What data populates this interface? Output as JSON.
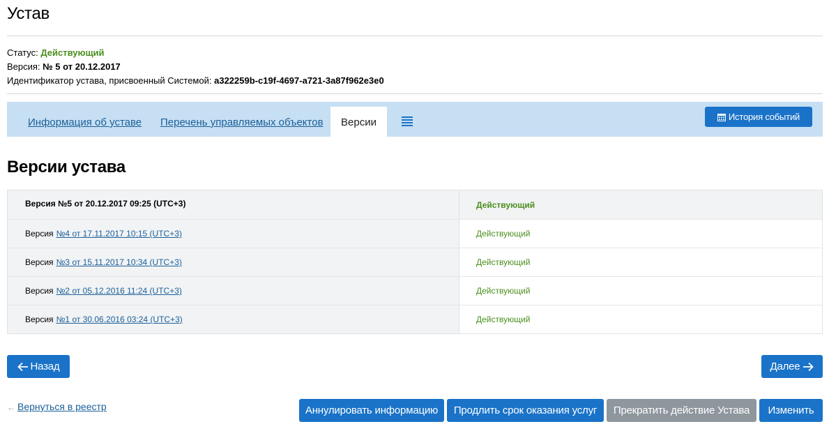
{
  "page": {
    "title": "Устав"
  },
  "meta": {
    "status_label": "Статус:",
    "status_value": "Действующий",
    "version_label": "Версия:",
    "version_value": "№ 5 от 20.12.2017",
    "id_label": "Идентификатор устава, присвоенный Системой:",
    "id_value": "a322259b-c19f-4697-a721-3a87f962e3e0"
  },
  "tabs": [
    {
      "label": "Информация об уставе"
    },
    {
      "label": "Перечень управляемых объектов"
    },
    {
      "label": "Версии"
    }
  ],
  "history_button": {
    "label": "История событий",
    "icon": "calendar-icon"
  },
  "section": {
    "title": "Версии устава"
  },
  "versions": [
    {
      "prefix": "Версия №5 от 20.12.2017 09:25 (UTC+3)",
      "link": "",
      "status": "Действующий"
    },
    {
      "prefix": "Версия",
      "link": "№4 от 17.11.2017 10:15 (UTC+3)",
      "status": "Действующий"
    },
    {
      "prefix": "Версия",
      "link": "№3 от 15.11.2017 10:34 (UTC+3)",
      "status": "Действующий"
    },
    {
      "prefix": "Версия",
      "link": "№2 от 05.12.2016 11:24 (UTC+3)",
      "status": "Действующий"
    },
    {
      "prefix": "Версия",
      "link": "№1 от 30.06.2016 03:24 (UTC+3)",
      "status": "Действующий"
    }
  ],
  "nav": {
    "back_label": "Назад",
    "next_label": "Далее"
  },
  "registry_link": "Вернуться в реестр",
  "actions": {
    "annul": "Аннулировать информацию",
    "extend": "Продлить срок оказания услуг",
    "terminate": "Прекратить действие Устава",
    "edit": "Изменить"
  },
  "colors": {
    "accent": "#1a73c8",
    "status_ok": "#4a8f1e",
    "tabbar": "#c7dff3",
    "disabled": "#8e969e"
  }
}
